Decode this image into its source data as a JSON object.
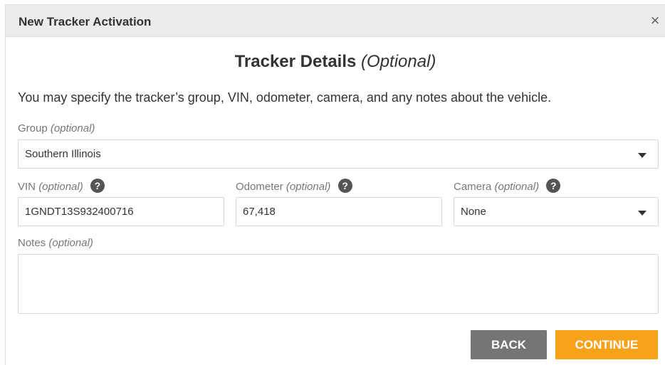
{
  "dialog": {
    "title": "New Tracker Activation",
    "close_glyph": "×"
  },
  "heading": {
    "main": "Tracker Details",
    "suffix": "(Optional)"
  },
  "description": "You may specify the tracker’s group, VIN, odometer, camera, and any notes about the vehicle.",
  "group": {
    "label": "Group",
    "optional": "(optional)",
    "value": "Southern Illinois"
  },
  "vin": {
    "label": "VIN",
    "optional": "(optional)",
    "value": "1GNDT13S932400716"
  },
  "odometer": {
    "label": "Odometer",
    "optional": "(optional)",
    "value": "67,418"
  },
  "camera": {
    "label": "Camera",
    "optional": "(optional)",
    "value": "None"
  },
  "notes": {
    "label": "Notes",
    "optional": "(optional)",
    "value": ""
  },
  "help_glyph": "?",
  "buttons": {
    "back": "BACK",
    "continue": "CONTINUE"
  },
  "colors": {
    "continue_button": "#f7a21b",
    "back_button": "#757575",
    "titlebar": "#ececec"
  },
  "icons": {
    "close": "close-icon",
    "help": "question-circle-icon",
    "dropdown": "caret-down-icon"
  }
}
